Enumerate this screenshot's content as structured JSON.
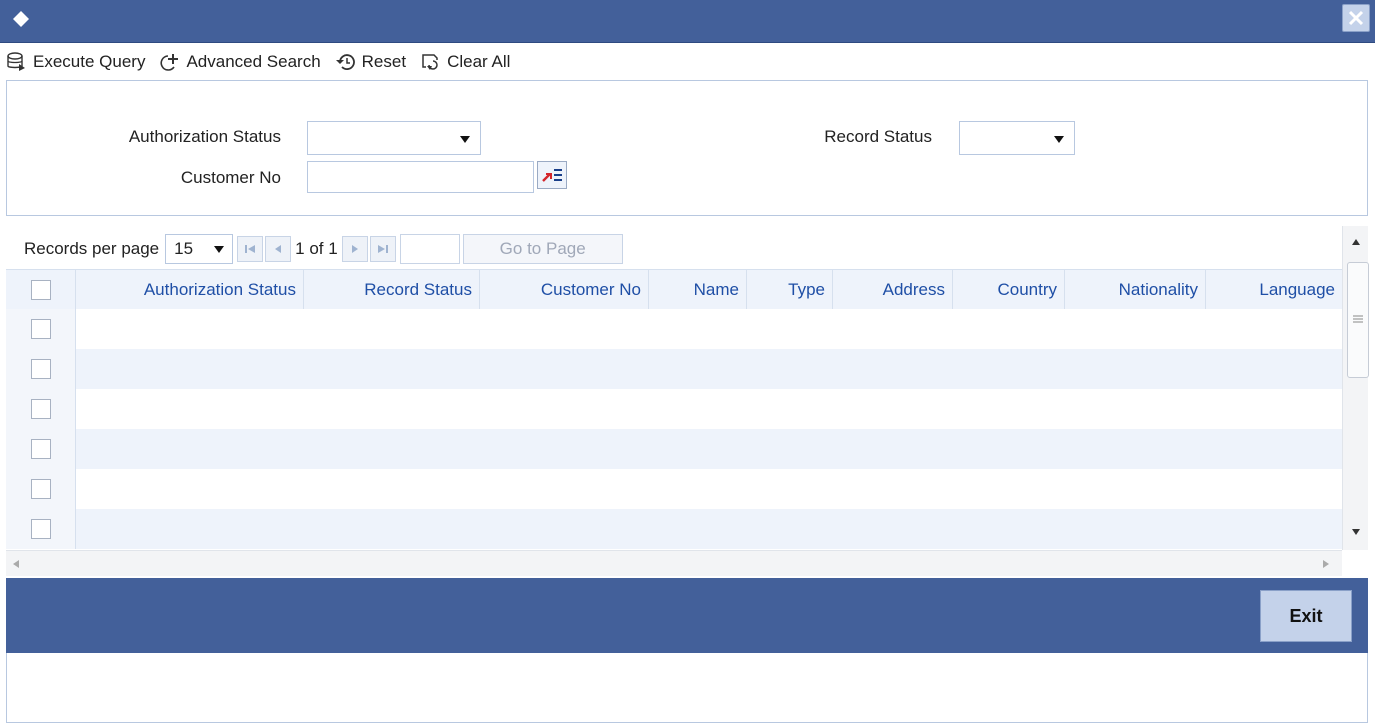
{
  "toolbar": {
    "execute_query": "Execute Query",
    "advanced_search": "Advanced Search",
    "reset": "Reset",
    "clear_all": "Clear All"
  },
  "search": {
    "authorization_status_label": "Authorization Status",
    "authorization_status_value": "",
    "record_status_label": "Record Status",
    "record_status_value": "",
    "customer_no_label": "Customer No",
    "customer_no_value": ""
  },
  "pager": {
    "records_per_page_label": "Records per page",
    "records_per_page_value": "15",
    "page_info": "1 of 1",
    "goto_value": "",
    "goto_button": "Go to Page"
  },
  "grid": {
    "columns": [
      "Authorization Status",
      "Record Status",
      "Customer No",
      "Name",
      "Type",
      "Address",
      "Country",
      "Nationality",
      "Language"
    ],
    "rows": [
      {
        "checked": false
      },
      {
        "checked": false
      },
      {
        "checked": false
      },
      {
        "checked": false
      },
      {
        "checked": false
      },
      {
        "checked": false
      }
    ]
  },
  "footer": {
    "exit": "Exit"
  },
  "colors": {
    "titlebar": "#43609a",
    "header_text": "#1f4fa6",
    "panel_border": "#b8c8e0"
  }
}
